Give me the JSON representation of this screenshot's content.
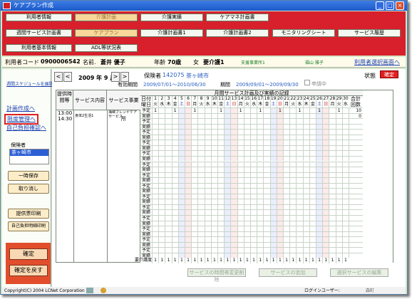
{
  "window": {
    "title": "ケアプラン作成"
  },
  "tabs": {
    "row1": [
      "利用者情報",
      "介護計画",
      "介護実績",
      "ケアマネ計画書"
    ],
    "row2": [
      "週間サービス計画書",
      "ケアプラン",
      "介護計画書1",
      "介護計画書2",
      "モニタリングシート",
      "サービス履歴"
    ],
    "row3": [
      "利用者基本情報",
      "ADL等状況表"
    ],
    "active": [
      "介護計画",
      "ケアプラン"
    ]
  },
  "info": {
    "code_label": "利用者コード",
    "code_value": "0900006542",
    "name_label": "名前.",
    "name_value": "蒼井 優子",
    "age_label": "年齢",
    "age_value": "70歳",
    "gender": "女",
    "care_level": "要介護1",
    "office": "支援事業所1",
    "manager": "福山 雅子",
    "select_link": "利用者選択画面へ"
  },
  "sidebar": {
    "top_link": "週間スケジュールを展開",
    "links": [
      "計画作成へ",
      "限度管理へ",
      "自己負担確認へ"
    ],
    "insurer_label": "保険者",
    "insurer_item": "茶ヶ崎市",
    "buttons": [
      "一時保存",
      "取り消し",
      "提供票印刷",
      "自己負担明細印刷"
    ],
    "red_buttons": [
      "確定",
      "確定を戻す"
    ]
  },
  "main": {
    "prev_btn": "<",
    "next_btn": ">",
    "month": "2009 年 9 月",
    "insurer_label": "保険者",
    "insurer_code": "142075",
    "insurer_name": "茶ヶ崎市",
    "valid_label": "有効期間",
    "valid_value": "2009/07/01〜2010/06/30",
    "period_label": "期間",
    "period_value": "2009/09/01〜2009/09/30",
    "apply_label": "申請中",
    "status_label": "状態",
    "status_value": "確定",
    "col_time": "提供時間等",
    "col_content": "サービス内容",
    "col_provider": "サービス事業所",
    "grid_title": "月間サービス計画及び実績の記録",
    "day_label": "日付",
    "weekday_label": "曜日",
    "total_label": "合計",
    "count_label": "回数",
    "plan_label": "予定",
    "actual_label": "実績",
    "row1": {
      "time_start": "13:00",
      "time_end": "14:30",
      "content": "身体2生活1",
      "provider": "海峡フレンドケアサービス",
      "total": "10",
      "total_actual": "0"
    },
    "days": [
      "1",
      "2",
      "3",
      "4",
      "5",
      "6",
      "7",
      "8",
      "9",
      "10",
      "11",
      "12",
      "13",
      "14",
      "15",
      "16",
      "17",
      "18",
      "19",
      "20",
      "21",
      "22",
      "23",
      "24",
      "25",
      "26",
      "27",
      "28",
      "29",
      "30"
    ],
    "weekdays": [
      "火",
      "水",
      "木",
      "金",
      "土",
      "日",
      "月",
      "火",
      "水",
      "木",
      "金",
      "土",
      "日",
      "月",
      "火",
      "水",
      "木",
      "金",
      "土",
      "日",
      "月",
      "火",
      "水",
      "木",
      "金",
      "土",
      "日",
      "月",
      "火",
      "水"
    ],
    "row1_plan_marks": [
      "1",
      "",
      "",
      "1",
      "",
      "",
      "1",
      "",
      "",
      "",
      "1",
      "",
      "",
      "1",
      "",
      "",
      "1",
      "",
      "",
      "1",
      "",
      "",
      "1",
      "",
      "",
      "1",
      "",
      "",
      "1",
      ""
    ],
    "care_total_label": "要介護度",
    "care_totals": [
      "1",
      "1",
      "1",
      "1",
      "1",
      "1",
      "1",
      "1",
      "1",
      "1",
      "1",
      "1",
      "1",
      "1",
      "1",
      "1",
      "1",
      "1",
      "1",
      "1",
      "1",
      "1",
      "1",
      "1",
      "1",
      "1",
      "1",
      "1",
      "1",
      "1"
    ],
    "buttons": [
      "サービスの時間帯変更削除",
      "サービスの追加",
      "選択サービスの編集"
    ]
  },
  "status": {
    "copyright": "Copyright(C) 2004 LCNet Corporation",
    "login_label": "ログインユーザー:",
    "login_user": "森町"
  },
  "colors": {
    "red_panel": "#d7202c",
    "active_tab": "#f7d79a",
    "window_bg": "#d4e6c7"
  }
}
